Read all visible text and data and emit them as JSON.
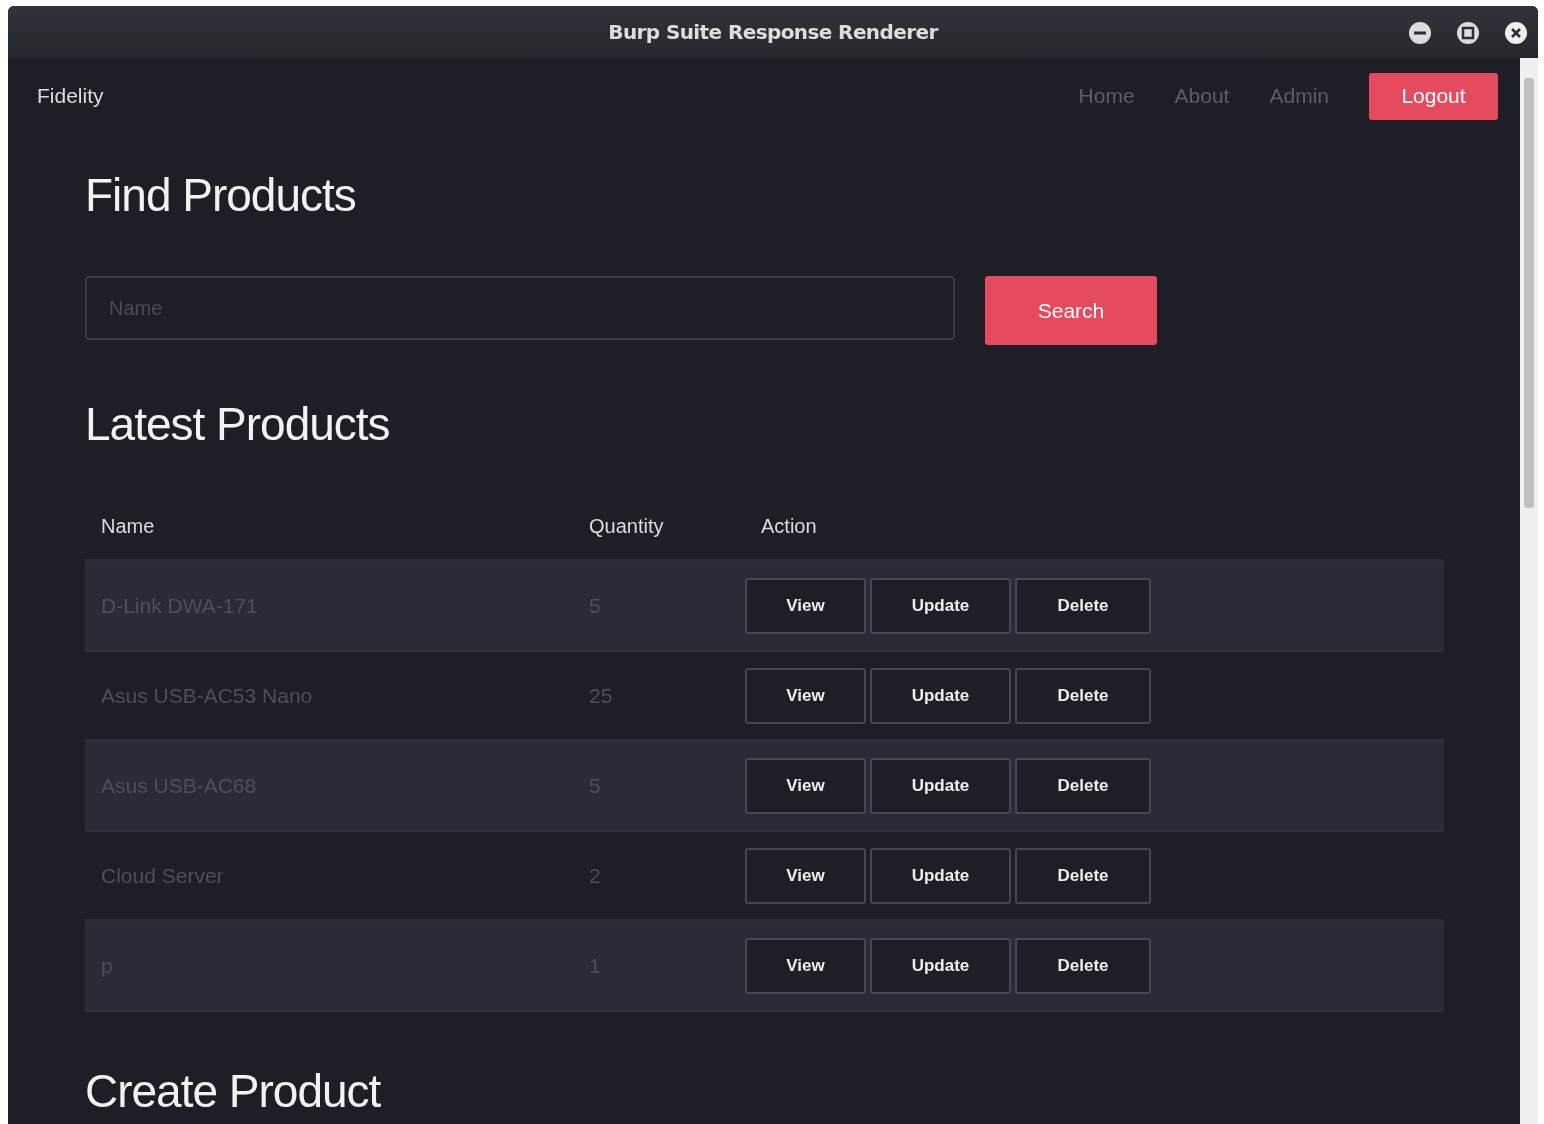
{
  "window": {
    "title": "Burp Suite Response Renderer"
  },
  "navbar": {
    "brand": "Fidelity",
    "links": [
      "Home",
      "About",
      "Admin"
    ],
    "logout": "Logout"
  },
  "find": {
    "heading": "Find Products",
    "search": {
      "placeholder": "Name"
    },
    "button": "Search"
  },
  "latest": {
    "heading": "Latest Products",
    "columns": [
      "Name",
      "Quantity",
      "Action"
    ],
    "rows": [
      {
        "name": "D-Link DWA-171",
        "quantity": "5",
        "actions": [
          "View",
          "Update",
          "Delete"
        ]
      },
      {
        "name": "Asus USB-AC53 Nano",
        "quantity": "25",
        "actions": [
          "View",
          "Update",
          "Delete"
        ]
      },
      {
        "name": "Asus USB-AC68",
        "quantity": "5",
        "actions": [
          "View",
          "Update",
          "Delete"
        ]
      },
      {
        "name": "Cloud Server",
        "quantity": "2",
        "actions": [
          "View",
          "Update",
          "Delete"
        ]
      },
      {
        "name": "p",
        "quantity": "1",
        "actions": [
          "View",
          "Update",
          "Delete"
        ]
      }
    ]
  },
  "create": {
    "heading": "Create Product"
  }
}
